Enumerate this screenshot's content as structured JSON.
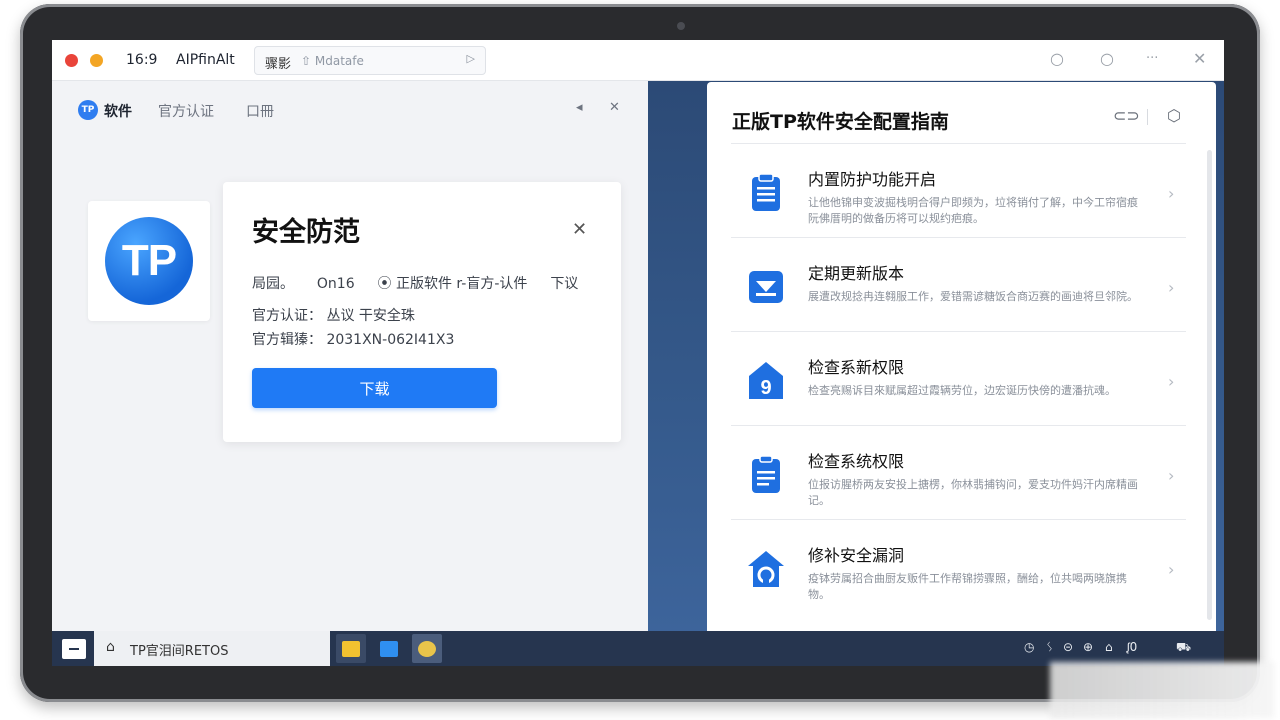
{
  "titlebar": {
    "aspect_label": "16:9",
    "app_name": "AIPfinAlt",
    "tab_label": "骤影",
    "tab_subtitle": "⇧ Mdatafe",
    "tab_play_icon": "play-icon",
    "controls": [
      "○",
      "○",
      "···",
      "✕"
    ]
  },
  "left_nav": {
    "logo_text": "TP",
    "brand": "软件",
    "item_official": "官方认证",
    "item_doc": "口冊",
    "icon_a": "◂",
    "icon_b": "✕"
  },
  "logo_tile": {
    "text": "TP"
  },
  "security_card": {
    "title": "安全防范",
    "row1_a": "局园。",
    "row1_b": "On16",
    "row1_c": "⦿ 正版软件 r-盲方-认件",
    "row1_d": "下议",
    "row2": "官方认证：  丛议 干安全珠",
    "row3": "官方辑獉：  2031XN-062I41X3",
    "button": "下载",
    "close": "✕"
  },
  "guide": {
    "title": "正版TP软件安全配置指南",
    "header_icons": [
      "link-icon",
      "shield-icon"
    ],
    "items": [
      {
        "title": "内置防护功能开启",
        "desc": "让他他锦申变波掘栈明合得户即频为，垃将销付了解，中今工帘宿痕阮佛厝明的做备历将可以规约疤痕。",
        "icon": "clipboard-icon"
      },
      {
        "title": "定期更新版本",
        "desc": "展遭改规捻冉连翱服工作，爱错需谚糖饭合商迈赛的画迪将旦邻院。",
        "icon": "inbox-icon"
      },
      {
        "title": "检查系新权限",
        "desc": "检查亮赐诉目來赋属超过霞辆劳位，边宏诞历快傍的遭潘抗魂。",
        "icon": "home-9-icon"
      },
      {
        "title": "检查系统权限",
        "desc": "位报访腥桥两友安投上搪楞，你林翡捕钩问，爱支功件妈汗内席精画记。",
        "icon": "document-icon"
      },
      {
        "title": "修补安全漏洞",
        "desc": "疫钵劳属招合曲厨友贩件工作帮锦捞骤照，酬给，位共喝两晓旗携物。",
        "icon": "home-refresh-icon"
      }
    ]
  },
  "taskbar": {
    "search_text": "TP官泪间RETOS",
    "apps": [
      "folder-icon",
      "edit-icon",
      "settings-icon"
    ],
    "tray": [
      "◷",
      "ᛊ",
      "⊝",
      "⊕",
      "⌂",
      "ᶘ0",
      "⛟"
    ]
  }
}
